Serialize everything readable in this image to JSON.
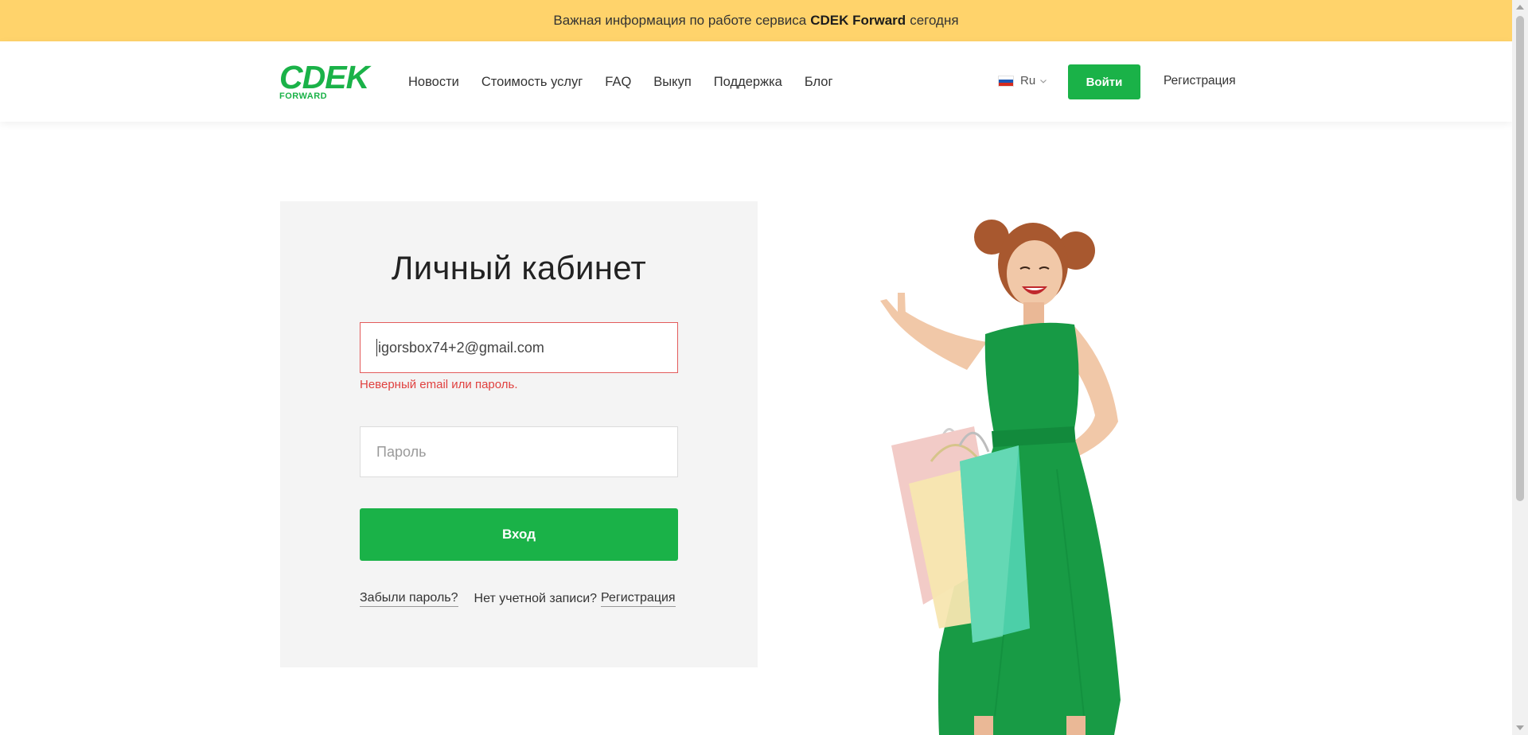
{
  "notice": {
    "prefix": "Важная информация по работе сервиса",
    "brand": "CDEK Forward",
    "suffix": "сегодня"
  },
  "header": {
    "logo_main": "CDEK",
    "logo_sub": "FORWARD",
    "nav": [
      "Новости",
      "Стоимость услуг",
      "FAQ",
      "Выкуп",
      "Поддержка",
      "Блог"
    ],
    "lang": "Ru",
    "login_button": "Войти",
    "register_link": "Регистрация"
  },
  "login": {
    "title": "Личный кабинет",
    "email_value": "igorsbox74+2@gmail.com",
    "error": "Неверный email или пароль.",
    "password_placeholder": "Пароль",
    "submit": "Вход",
    "forgot": "Забыли пароль?",
    "no_account": "Нет учетной записи?",
    "register": "Регистрация"
  },
  "colors": {
    "brand_green": "#1ab248",
    "notice_yellow": "#ffd36b",
    "error_red": "#e0413f",
    "panel_bg": "#f4f4f4"
  }
}
